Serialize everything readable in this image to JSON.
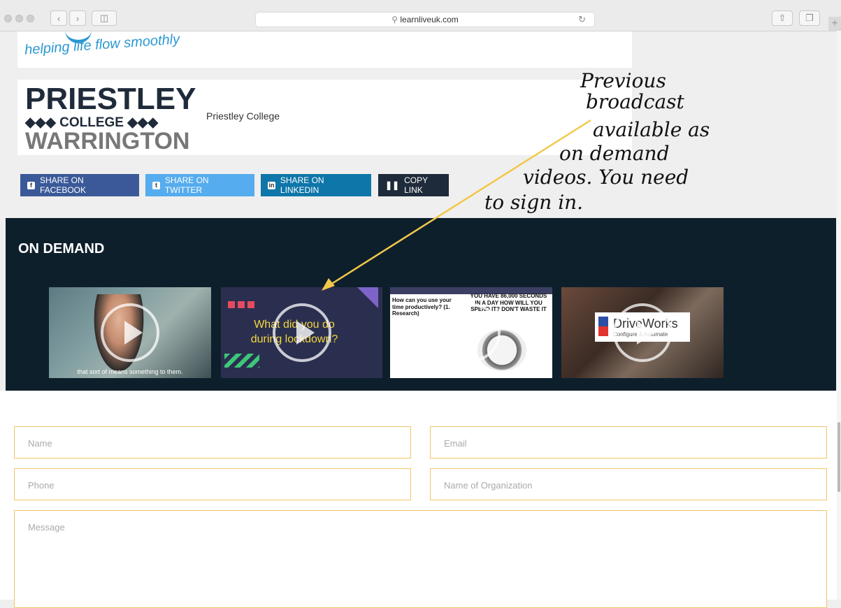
{
  "browser": {
    "url": "learnliveuk.com"
  },
  "logos": {
    "tagline": "helping life flow smoothly",
    "college_line1": "PRIESTLEY",
    "college_line2": "◆◆◆ COLLEGE ◆◆◆",
    "college_line3": "WARRINGTON",
    "college_name": "Priestley College"
  },
  "share": {
    "facebook": "SHARE ON FACEBOOK",
    "twitter": "SHARE ON TWITTER",
    "linkedin": "SHARE ON LINKEDIN",
    "copy": "COPY LINK"
  },
  "on_demand": {
    "title": "ON DEMAND",
    "video1_caption": "that sort of means something to them.",
    "video2_text": "What did you do during lockdown?",
    "video3_left": "How can you use your time productively? (1. Research)",
    "video3_right": "YOU HAVE 86,000 SECONDS IN A DAY HOW WILL YOU SPEND IT? DON'T WASTE IT",
    "video4_brand": "DriveWorks",
    "video4_sub": "Configure & Automate"
  },
  "form": {
    "name": "Name",
    "email": "Email",
    "phone": "Phone",
    "organization": "Name of Organization",
    "message": "Message"
  },
  "annotation": {
    "line1": "Previous",
    "line2": "broadcast",
    "line3": "available as",
    "line4": "on demand",
    "line5": "videos. You need",
    "line6": "to sign in."
  },
  "colors": {
    "facebook": "#3b5998",
    "twitter": "#55acee",
    "linkedin": "#0e76a8",
    "copy": "#1d2b3a",
    "dark": "#0e1f2c",
    "field_border": "#f0c566",
    "arrow": "#f2c849"
  }
}
